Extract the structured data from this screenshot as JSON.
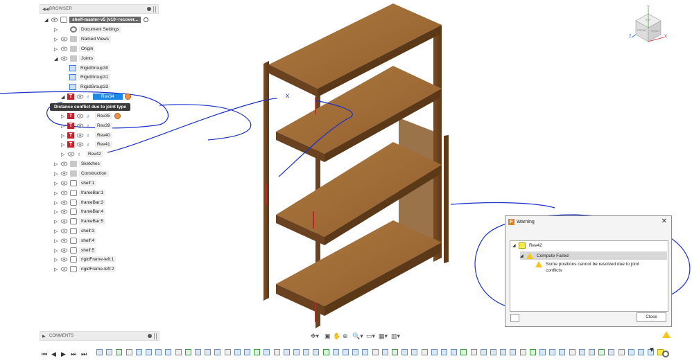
{
  "browser": {
    "title": "BROWSER",
    "root_label": "shelf-master-v5 (v10~recover...",
    "tooltip": "Distance conflict due to joint type",
    "items": [
      {
        "label": "Document Settings",
        "type": "gear"
      },
      {
        "label": "Named Views",
        "type": "folder"
      },
      {
        "label": "Origin",
        "type": "folder"
      },
      {
        "label": "Joints",
        "type": "folder"
      },
      {
        "label": "RigidGroup30",
        "type": "rigid"
      },
      {
        "label": "RigidGroup31",
        "type": "rigid"
      },
      {
        "label": "RigidGroup33",
        "type": "rigid"
      },
      {
        "label": "Rev34",
        "type": "joint"
      },
      {
        "label": "Rev35",
        "type": "joint"
      },
      {
        "label": "Rev39",
        "type": "joint"
      },
      {
        "label": "Rev40",
        "type": "joint"
      },
      {
        "label": "Rev41",
        "type": "joint"
      },
      {
        "label": "Rev42",
        "type": "joint"
      },
      {
        "label": "Sketches",
        "type": "folder"
      },
      {
        "label": "Construction",
        "type": "folder"
      },
      {
        "label": "shelf:1",
        "type": "component"
      },
      {
        "label": "frameBar:1",
        "type": "component"
      },
      {
        "label": "frameBar:3",
        "type": "component"
      },
      {
        "label": "frameBar:4",
        "type": "component"
      },
      {
        "label": "frameBar:5",
        "type": "component"
      },
      {
        "label": "shelf:3",
        "type": "component"
      },
      {
        "label": "shelf:4",
        "type": "component"
      },
      {
        "label": "shelf:5",
        "type": "component"
      },
      {
        "label": "rigidFrame-left:1",
        "type": "component"
      },
      {
        "label": "rigidFrame-left:2",
        "type": "component"
      }
    ]
  },
  "comments": {
    "title": "COMMENTS"
  },
  "warning": {
    "title": "Warning",
    "tree": {
      "item": "Rev42",
      "status": "Compute Failed",
      "message": "Some positions cannot be resolved due to joint conflicts"
    },
    "close_label": "Close"
  },
  "viewcube": {
    "top": "TOP",
    "front": "FRONT",
    "right": "RIGHT",
    "axis_x": "X",
    "axis_y": "Y",
    "axis_z": "Z"
  },
  "annotation_mark": "x",
  "colors": {
    "selection": "#1e88e5",
    "joint_error": "#c8202a",
    "wood": "#8a5a2b",
    "annotation": "#1a2fc8",
    "warning": "#f5c518"
  }
}
